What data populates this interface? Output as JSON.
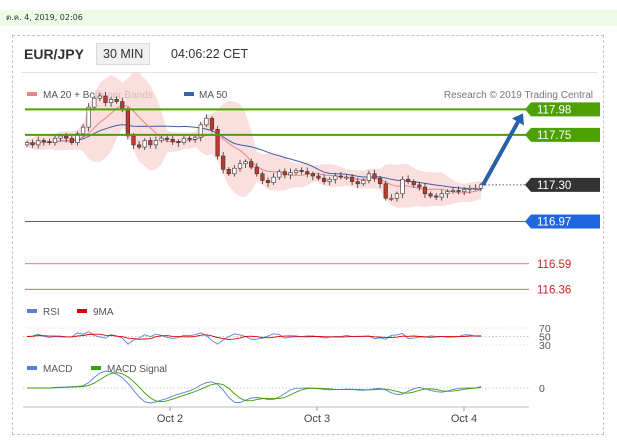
{
  "header": {
    "date_line": "ต.ค. 4, 2019, 02:06",
    "pair": "EUR/JPY",
    "timeframe": "30 MIN",
    "time": "04:06:22 CET"
  },
  "legend": {
    "ma20": "MA 20 + Bollinger Bands",
    "ma50": "MA 50",
    "credit": "Research © 2019 Trading Central",
    "rsi": "RSI",
    "rsi_ma": "9MA",
    "macd": "MACD",
    "macd_signal": "MACD Signal"
  },
  "colors": {
    "green_level": "#4ca100",
    "red_level": "#e7454b",
    "blue_level": "#1f66e0",
    "current": "#333333",
    "arrow": "#2660a8",
    "ma20": "#e8878a",
    "ma50": "#3a62a8",
    "bollinger": "#fad6d6",
    "rsi": "#5a7fd6",
    "rsi_ma": "#e00000",
    "macd": "#5a7fd6",
    "macd_signal": "#3aa000"
  },
  "chart_data": {
    "type": "candlestick",
    "pair": "EUR/JPY",
    "timeframe": "30 MIN",
    "x_ticks": [
      "Oct 2",
      "Oct 3",
      "Oct 4"
    ],
    "levels": [
      {
        "value": 117.98,
        "label": "117.98",
        "style": "green"
      },
      {
        "value": 117.75,
        "label": "117.75",
        "style": "green"
      },
      {
        "value": 117.3,
        "label": "117.30",
        "style": "current"
      },
      {
        "value": 116.97,
        "label": "116.97",
        "style": "blue"
      },
      {
        "value": 116.59,
        "label": "116.59",
        "style": "red"
      },
      {
        "value": 116.36,
        "label": "116.36",
        "style": "red"
      }
    ],
    "price_path": [
      117.68,
      117.66,
      117.7,
      117.69,
      117.68,
      117.72,
      117.74,
      117.72,
      117.68,
      117.76,
      117.82,
      118.0,
      118.08,
      118.1,
      118.04,
      118.07,
      118.05,
      117.98,
      117.74,
      117.66,
      117.64,
      117.7,
      117.66,
      117.7,
      117.72,
      117.71,
      117.69,
      117.68,
      117.72,
      117.71,
      117.73,
      117.84,
      117.9,
      117.8,
      117.56,
      117.44,
      117.4,
      117.45,
      117.49,
      117.51,
      117.46,
      117.4,
      117.34,
      117.32,
      117.37,
      117.42,
      117.39,
      117.41,
      117.43,
      117.42,
      117.4,
      117.38,
      117.36,
      117.33,
      117.35,
      117.38,
      117.37,
      117.37,
      117.33,
      117.31,
      117.34,
      117.4,
      117.36,
      117.31,
      117.18,
      117.18,
      117.22,
      117.35,
      117.33,
      117.3,
      117.28,
      117.22,
      117.2,
      117.19,
      117.22,
      117.24,
      117.25,
      117.24,
      117.26,
      117.27,
      117.27,
      117.3
    ],
    "price_axis_range": [
      116.3,
      118.1
    ],
    "forecast_target": 117.98,
    "rsi": {
      "levels": [
        "70",
        "50",
        "30"
      ]
    },
    "macd": {
      "zero_label": "0"
    }
  }
}
